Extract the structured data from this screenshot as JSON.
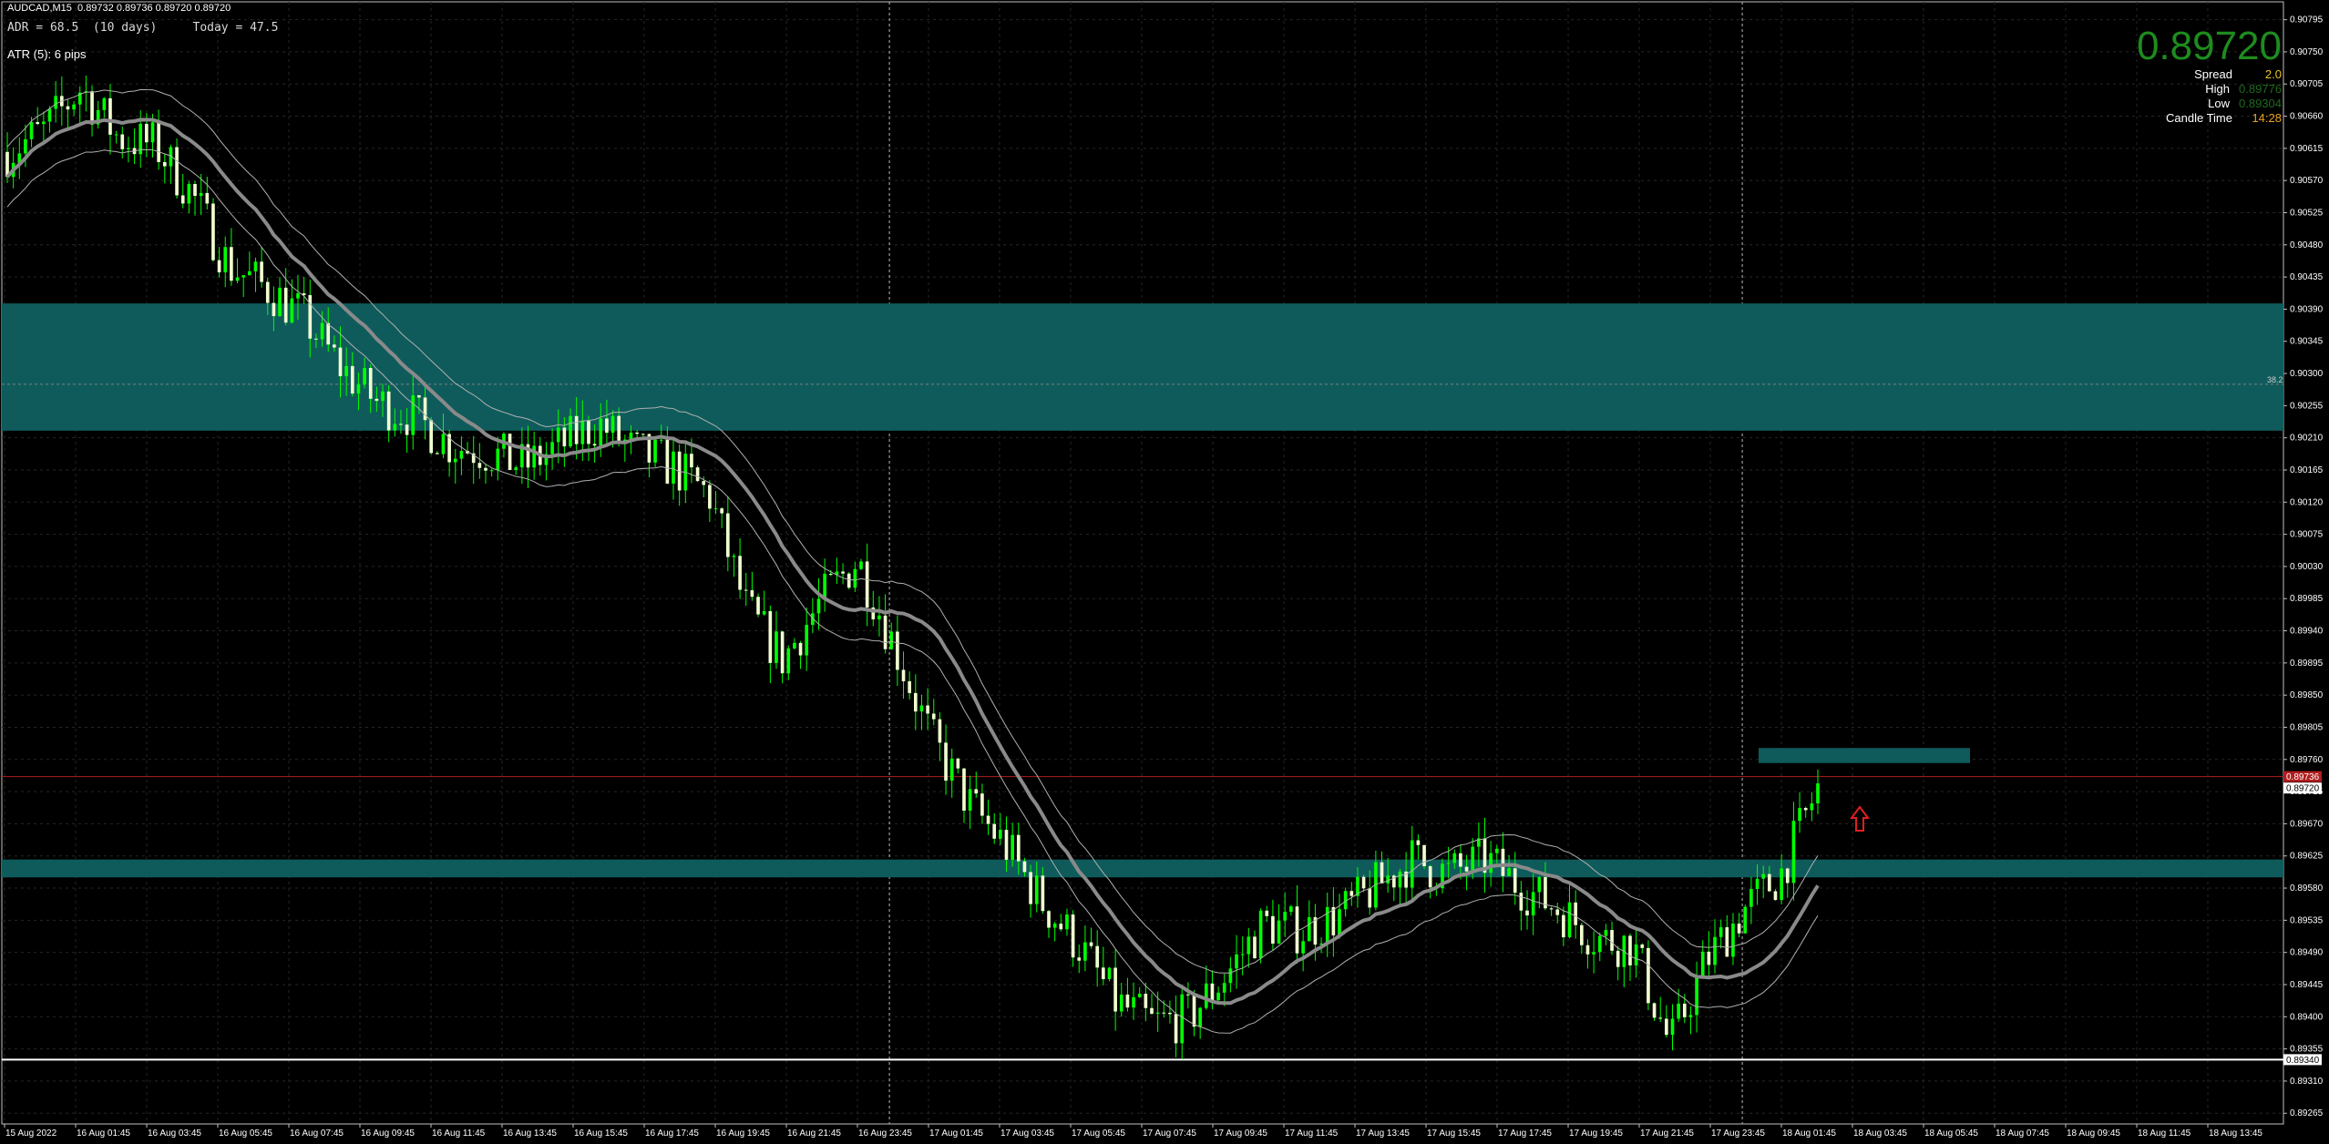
{
  "header": {
    "symbol_info": "AUDCAD,M15  0.89732 0.89736 0.89720 0.89720",
    "adr_text": "ADR = 68.5  (10 days)     Today = 47.5",
    "atr_text": "ATR (5): 6 pips"
  },
  "info_panel": {
    "price": "0.89720",
    "rows": [
      {
        "label": "Spread",
        "value": "2.0",
        "color": "#e8c22a"
      },
      {
        "label": "High",
        "value": "0.89776",
        "color": "#1e6a1e"
      },
      {
        "label": "Low",
        "value": "0.89304",
        "color": "#1e6a1e"
      },
      {
        "label": "Candle Time",
        "value": "14:28",
        "color": "#e8a020"
      }
    ]
  },
  "chart_data": {
    "type": "candlestick",
    "price_ticks": [
      "0.90795",
      "0.90750",
      "0.90705",
      "0.90660",
      "0.90615",
      "0.90570",
      "0.90525",
      "0.90480",
      "0.90435",
      "0.90390",
      "0.90345",
      "0.90300",
      "0.90255",
      "0.90210",
      "0.90165",
      "0.90120",
      "0.90075",
      "0.90030",
      "0.89985",
      "0.89940",
      "0.89895",
      "0.89850",
      "0.89805",
      "0.89760",
      "0.89715",
      "0.89670",
      "0.89625",
      "0.89580",
      "0.89535",
      "0.89490",
      "0.89445",
      "0.89400",
      "0.89355",
      "0.89310",
      "0.89265"
    ],
    "time_ticks": [
      "15 Aug 2022",
      "16 Aug 01:45",
      "16 Aug 03:45",
      "16 Aug 05:45",
      "16 Aug 07:45",
      "16 Aug 09:45",
      "16 Aug 11:45",
      "16 Aug 13:45",
      "16 Aug 15:45",
      "16 Aug 17:45",
      "16 Aug 19:45",
      "16 Aug 21:45",
      "16 Aug 23:45",
      "17 Aug 01:45",
      "17 Aug 03:45",
      "17 Aug 05:45",
      "17 Aug 07:45",
      "17 Aug 09:45",
      "17 Aug 11:45",
      "17 Aug 13:45",
      "17 Aug 15:45",
      "17 Aug 17:45",
      "17 Aug 19:45",
      "17 Aug 21:45",
      "17 Aug 23:45",
      "18 Aug 01:45",
      "18 Aug 03:45",
      "18 Aug 05:45",
      "18 Aug 07:45",
      "18 Aug 09:45",
      "18 Aug 11:45",
      "18 Aug 13:45"
    ],
    "y_range": [
      0.8925,
      0.9082
    ],
    "zones": [
      {
        "from": 0.9022,
        "to": 0.90398,
        "color": "#0f5b5b"
      },
      {
        "from": 0.89595,
        "to": 0.8962,
        "color": "#0f5b5b"
      }
    ],
    "target_box": {
      "price_top": 0.89776,
      "price_bottom": 0.89755,
      "color": "#0f5b5b"
    },
    "horizontal_lines": [
      {
        "price": 0.89736,
        "color": "#b01e1e",
        "label": "0.89736"
      },
      {
        "price": 0.8934,
        "color": "#ffffff",
        "label": "0.89340"
      },
      {
        "price": 0.90285,
        "color": "#808080",
        "dashed": true,
        "label": "38.2"
      }
    ],
    "current_price": "0.89720",
    "vertical_session_lines": [
      12,
      24,
      36
    ],
    "anchors": [
      0.9061,
      0.9064,
      0.907,
      0.9063,
      0.9062,
      0.9055,
      0.9045,
      0.9042,
      0.9038,
      0.9031,
      0.9026,
      0.9024,
      0.902,
      0.9019,
      0.9017,
      0.902,
      0.9023,
      0.9019,
      0.9017,
      0.9013,
      0.8997,
      0.899,
      0.8998,
      0.9004,
      0.8992,
      0.8979,
      0.897,
      0.8964,
      0.8956,
      0.895,
      0.8942,
      0.8939,
      0.894,
      0.8946,
      0.8953,
      0.8952,
      0.8954,
      0.8958,
      0.8962,
      0.896,
      0.8962,
      0.8958,
      0.8955,
      0.8951,
      0.895,
      0.8936,
      0.8948,
      0.8955,
      0.896,
      0.8972
    ],
    "bar_count": 300,
    "candle_up_color": "#00ff00",
    "candle_down_color": "#f0ffd0"
  }
}
